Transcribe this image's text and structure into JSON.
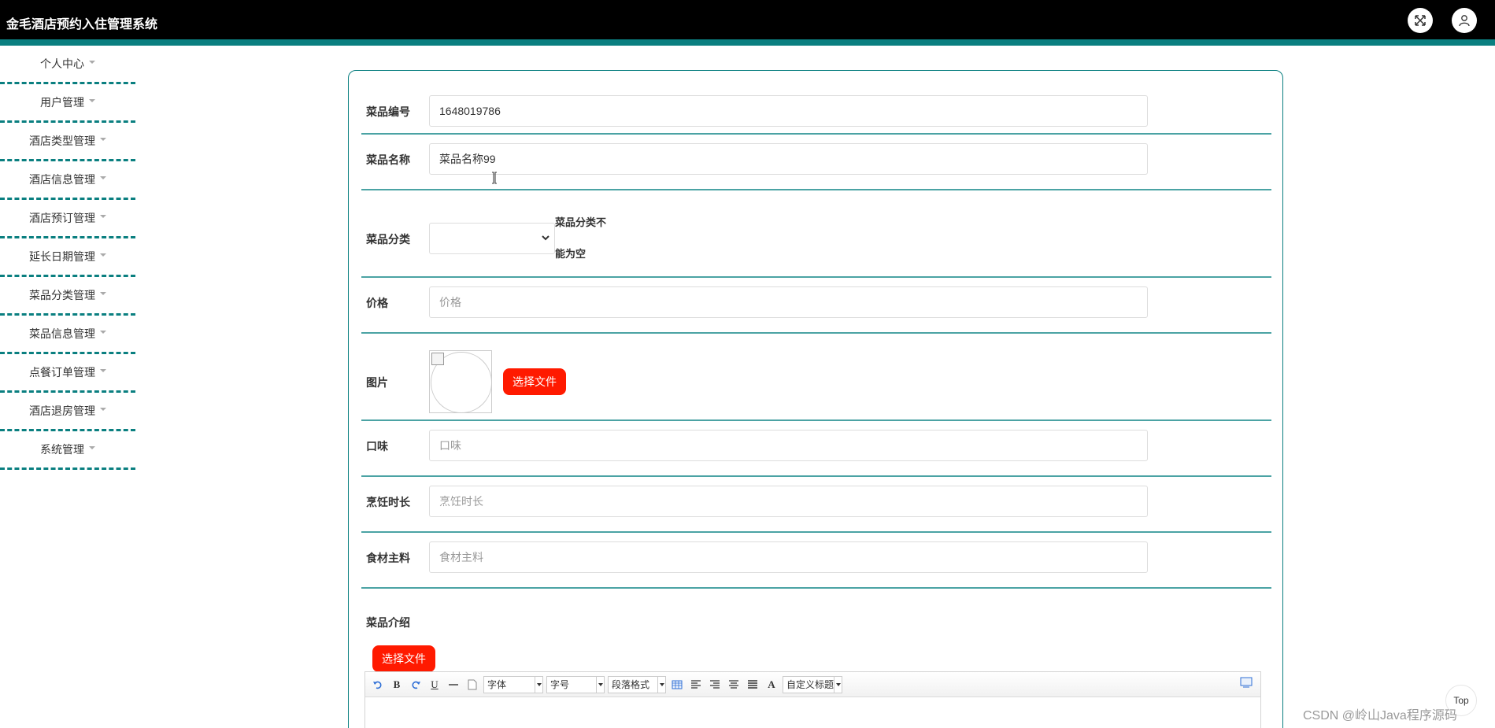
{
  "app": {
    "title": "金毛酒店预约入住管理系统"
  },
  "topbar": {
    "fullscreen_icon": "fullscreen-icon",
    "user_icon": "user-icon"
  },
  "sidebar": {
    "items": [
      {
        "label": "个人中心"
      },
      {
        "label": "用户管理"
      },
      {
        "label": "酒店类型管理"
      },
      {
        "label": "酒店信息管理"
      },
      {
        "label": "酒店预订管理"
      },
      {
        "label": "延长日期管理"
      },
      {
        "label": "菜品分类管理"
      },
      {
        "label": "菜品信息管理"
      },
      {
        "label": "点餐订单管理"
      },
      {
        "label": "酒店退房管理"
      },
      {
        "label": "系统管理"
      }
    ]
  },
  "form": {
    "code": {
      "label": "菜品编号",
      "value": "1648019786"
    },
    "name": {
      "label": "菜品名称",
      "value": "菜品名称99"
    },
    "category": {
      "label": "菜品分类",
      "value": "",
      "error_line1": "菜品分类不",
      "error_line2": "能为空"
    },
    "price": {
      "label": "价格",
      "placeholder": "价格"
    },
    "image": {
      "label": "图片",
      "button": "选择文件"
    },
    "taste": {
      "label": "口味",
      "placeholder": "口味"
    },
    "cook_time": {
      "label": "烹饪时长",
      "placeholder": "烹饪时长"
    },
    "ingredients": {
      "label": "食材主料",
      "placeholder": "食材主料"
    },
    "intro": {
      "label": "菜品介绍",
      "button": "选择文件"
    }
  },
  "editor": {
    "font_combo": "字体",
    "size_combo": "字号",
    "para_combo": "段落格式",
    "custom_combo": "自定义标题",
    "bold": "B",
    "underline": "U",
    "font_color": "A"
  },
  "float": {
    "top_label": "Top"
  },
  "watermark": "CSDN @岭山Java程序源码"
}
